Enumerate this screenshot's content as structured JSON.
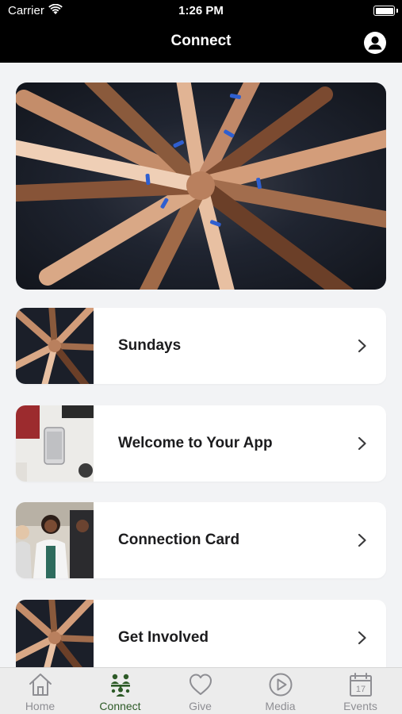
{
  "status_bar": {
    "carrier": "Carrier",
    "time": "1:26 PM"
  },
  "nav": {
    "title": "Connect",
    "profile_icon": "profile-icon"
  },
  "colors": {
    "accent": "#2d5a27",
    "nav_bg": "#000000",
    "background": "#f2f3f5"
  },
  "hero": {
    "image": "hands-together-photo"
  },
  "cards": [
    {
      "label": "Sundays",
      "thumb": "hands-together-photo"
    },
    {
      "label": "Welcome to Your App",
      "thumb": "phone-on-desk-photo"
    },
    {
      "label": "Connection Card",
      "thumb": "people-talking-photo"
    },
    {
      "label": "Get Involved",
      "thumb": "hands-together-photo"
    }
  ],
  "tabs": [
    {
      "label": "Home",
      "icon": "home-icon",
      "active": false
    },
    {
      "label": "Connect",
      "icon": "connect-icon",
      "active": true
    },
    {
      "label": "Give",
      "icon": "heart-icon",
      "active": false
    },
    {
      "label": "Media",
      "icon": "play-icon",
      "active": false
    },
    {
      "label": "Events",
      "icon": "calendar-icon",
      "active": false
    }
  ]
}
